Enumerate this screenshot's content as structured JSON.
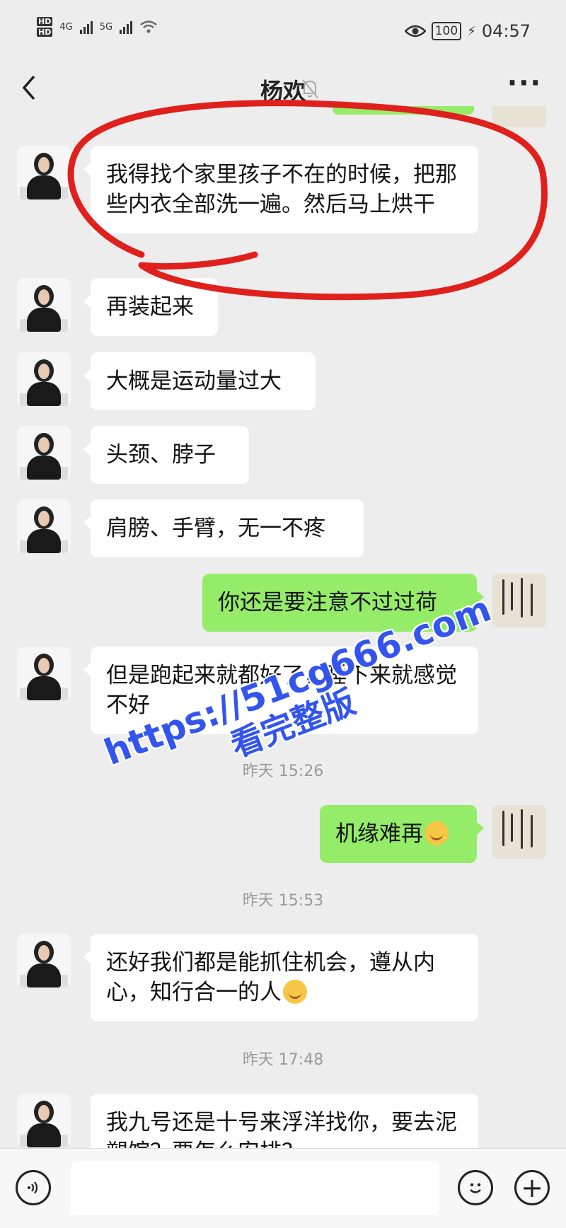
{
  "status_bar": {
    "hd1": "HD",
    "hd2": "HD",
    "net1": "4G",
    "net2": "5G",
    "battery": "100",
    "time": "04:57"
  },
  "header": {
    "back_icon": "chevron-left-icon",
    "title": "杨欢",
    "mute_icon": "bell-muted-icon",
    "more_icon": "more-dots-icon",
    "more_label": "···"
  },
  "messages": [
    {
      "side": "left",
      "text": "我得找个家里孩子不在的时候，把那些内衣全部洗一遍。然后马上烘干"
    },
    {
      "side": "left",
      "text": "再装起来"
    },
    {
      "side": "left",
      "text": "大概是运动量过大"
    },
    {
      "side": "left",
      "text": " 头颈、脖子"
    },
    {
      "side": "left",
      "text": "肩膀、手臂，无一不疼"
    },
    {
      "side": "right",
      "text": "你还是要注意不过过荷"
    },
    {
      "side": "left",
      "text": "但是跑起来就都好了，睡下来就感觉不好"
    },
    {
      "side": "right",
      "text": "机缘难再",
      "emoji": "laughing-crying-emoji"
    },
    {
      "side": "left",
      "text": "还好我们都是能抓住机会，遵从内心，知行合一的人",
      "emoji": "smile-emoji"
    },
    {
      "side": "left",
      "text": "我九号还是十号来浮洋找你，要去泥塑馆？要怎么安排？"
    }
  ],
  "timestamps": [
    "昨天 15:26",
    "昨天 15:53",
    "昨天 17:48"
  ],
  "watermark": {
    "line1": "https://51cg666.com",
    "line2": "看完整版"
  },
  "input_bar": {
    "voice_icon": "voice-icon",
    "emoji_icon": "emoji-icon",
    "plus_icon": "plus-icon",
    "plus_label": "+",
    "voice_label": "⦿"
  },
  "colors": {
    "background": "#ededed",
    "self_bubble": "#95ec69",
    "other_bubble": "#ffffff",
    "annotation": "#e0201c",
    "watermark": "#3355ee"
  }
}
